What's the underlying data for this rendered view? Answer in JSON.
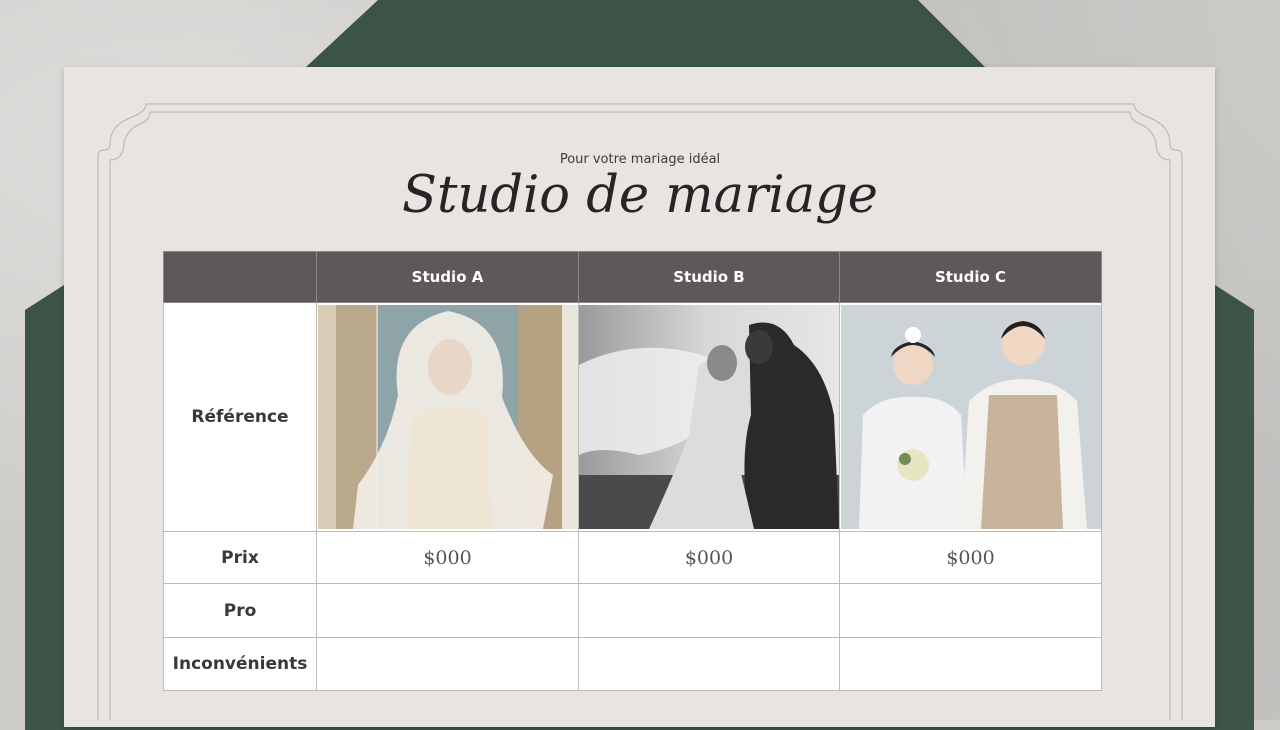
{
  "header": {
    "subtitle": "Pour votre mariage idéal",
    "title": "Studio de mariage"
  },
  "table": {
    "columns": [
      "",
      "Studio A",
      "Studio B",
      "Studio C"
    ],
    "rows": [
      {
        "label": "Référence",
        "cells": [
          "",
          "",
          ""
        ]
      },
      {
        "label": "Prix",
        "cells": [
          "$000",
          "$000",
          "$000"
        ]
      },
      {
        "label": "Pro",
        "cells": [
          "",
          "",
          ""
        ]
      },
      {
        "label": "Inconvénients",
        "cells": [
          "",
          "",
          ""
        ]
      }
    ]
  },
  "colors": {
    "envelope": "#3c5548",
    "card": "#e7e4e1",
    "header_row": "#5d585a"
  },
  "images": {
    "studio_a": "bride-with-veil-photo",
    "studio_b": "black-and-white-couple-veil-photo",
    "studio_c": "hanbok-couple-photo"
  }
}
